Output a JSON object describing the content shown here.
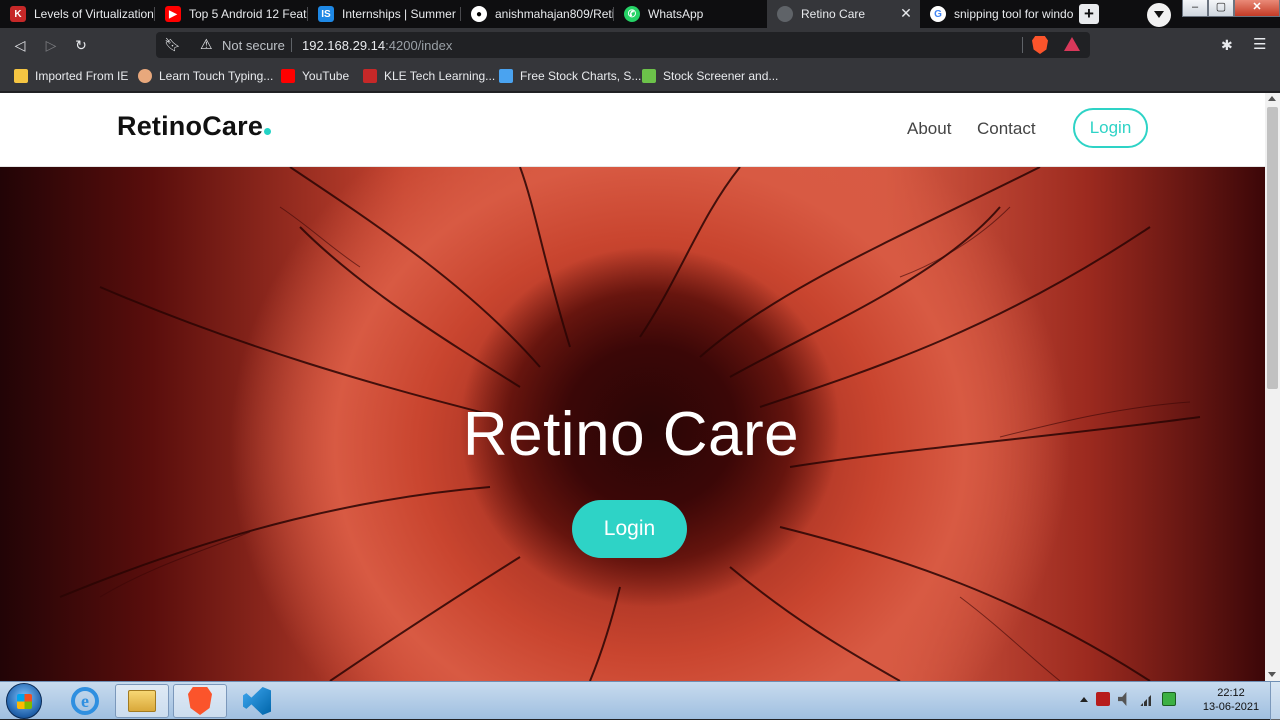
{
  "browser": {
    "tabs": [
      {
        "title": "Levels of Virtualization",
        "icon": "kle-icon",
        "color": "#c62828"
      },
      {
        "title": "Top 5 Android 12 Featu",
        "icon": "youtube-icon",
        "color": "#ff0000"
      },
      {
        "title": "Internships | Summer In",
        "icon": "internshala-icon",
        "color": "#1e88e5"
      },
      {
        "title": "anishmahajan809/Retin",
        "icon": "github-icon",
        "color": "#ffffff"
      },
      {
        "title": "WhatsApp",
        "icon": "whatsapp-icon",
        "color": "#25d366"
      },
      {
        "title": "Retino Care",
        "icon": "globe-icon",
        "color": "#9aa0a6",
        "active": true
      },
      {
        "title": "snipping tool for windo",
        "icon": "google-icon",
        "color": "#4285f4"
      }
    ],
    "address": {
      "security": "Not secure",
      "host": "192.168.29.14",
      "rest": ":4200/index"
    },
    "bookmarks": [
      {
        "label": "Imported From IE",
        "icon": "folder-icon",
        "color": "#f5c542"
      },
      {
        "label": "Learn Touch Typing...",
        "icon": "typing-icon",
        "color": "#e8a87c"
      },
      {
        "label": "YouTube",
        "icon": "youtube-icon",
        "color": "#ff0000"
      },
      {
        "label": "KLE Tech Learning...",
        "icon": "kle-icon",
        "color": "#c62828"
      },
      {
        "label": "Free Stock Charts, S...",
        "icon": "stockcharts-icon",
        "color": "#4aa3f0"
      },
      {
        "label": "Stock Screener and...",
        "icon": "screener-icon",
        "color": "#6cc24a"
      }
    ]
  },
  "site": {
    "logo": "RetinoCare",
    "nav": {
      "about": "About",
      "contact": "Contact",
      "login": "Login"
    },
    "hero": {
      "title": "Retino Care",
      "button": "Login"
    },
    "accent": "#2ed3c6"
  },
  "taskbar": {
    "time": "22:12",
    "date": "13-06-2021",
    "apps": [
      "internet-explorer-icon",
      "file-explorer-icon",
      "brave-icon",
      "vscode-icon"
    ]
  }
}
